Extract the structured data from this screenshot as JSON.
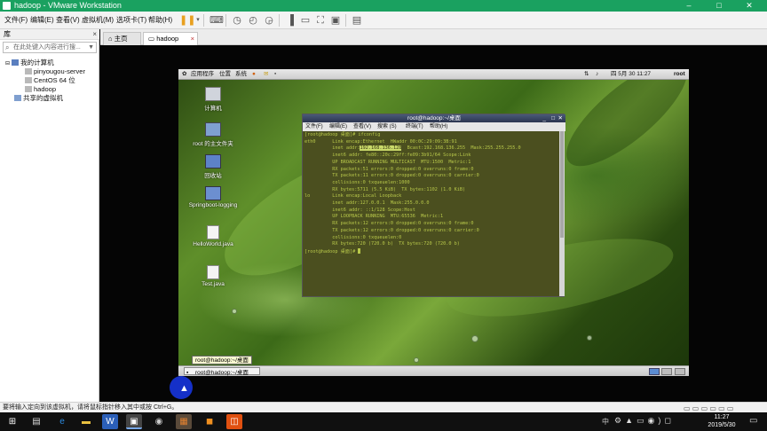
{
  "window": {
    "title": "hadoop - VMware Workstation",
    "controls": {
      "minimize": "–",
      "maximize": "□",
      "close": "✕"
    }
  },
  "menu": {
    "items": [
      "文件(F)",
      "编辑(E)",
      "查看(V)",
      "虚拟机(M)",
      "选项卡(T)",
      "帮助(H)"
    ]
  },
  "library": {
    "header": "库",
    "close": "×",
    "search_placeholder": "在此处键入内容进行搜...",
    "tree": {
      "root": "我的计算机",
      "items": [
        "pinyougou-server",
        "CentOS 64 位",
        "hadoop"
      ],
      "shared": "共享的虚拟机"
    }
  },
  "tabs": [
    {
      "label": "主页"
    },
    {
      "label": "hadoop",
      "close": "×"
    }
  ],
  "guest": {
    "top_panel": {
      "menus": [
        "应用程序",
        "位置",
        "系统"
      ],
      "clock": "四 5月 30 11:27",
      "user": "root"
    },
    "desktop_icons": [
      "计算机",
      "root 的主文件夹",
      "回收站",
      "Springboot-logging",
      "HelloWorld.java",
      "Test.java"
    ],
    "terminal": {
      "title": "root@hadoop:~/桌面",
      "menu": [
        "文件(F)",
        "编辑(E)",
        "查看(V)",
        "搜索 (S)",
        "终端(T)",
        "帮助(H)"
      ],
      "lines": [
        "[root@hadoop 桌面]# ifconfig",
        "eth0      Link encap:Ethernet  HWaddr 00:0C:29:09:3B:91",
        "inet6 addr: fe80::20c:29ff:fe09:3b91/64 Scope:Link",
        "          UP BROADCAST RUNNING MULTICAST  MTU:1500  Metric:1",
        "          RX packets:51 errors:0 dropped:0 overruns:0 frame:0",
        "          TX packets:11 errors:0 dropped:0 overruns:0 carrier:0",
        "          collisions:0 txqueuelen:1000",
        "          RX bytes:5711 (5.5 KiB)  TX bytes:1102 (1.0 KiB)",
        "",
        "lo        Link encap:Local Loopback",
        "          inet addr:127.0.0.1  Mask:255.0.0.0",
        "          inet6 addr: ::1/128 Scope:Host",
        "          UP LOOPBACK RUNNING  MTU:65536  Metric:1",
        "          RX packets:12 errors:0 dropped:0 overruns:0 frame:0",
        "          TX packets:12 errors:0 dropped:0 overruns:0 carrier:0",
        "          collisions:0 txqueuelen:0",
        "          RX bytes:720 (720.0 b)  TX bytes:720 (720.0 b)",
        "",
        "[root@hadoop 桌面]# "
      ],
      "inet_prefix": "          inet addr:",
      "inet_ip": "192.168.136.128",
      "inet_suffix": "  Bcast:192.168.136.255  Mask:255.255.255.0"
    },
    "bottom_panel": {
      "tooltip": "root@hadoop:~/桌面",
      "task": "root@hadoop:~/桌面"
    }
  },
  "statusbar": {
    "text": "要将输入定向到该虚拟机，请将鼠标指针移入其中或按 Ctrl+G。"
  },
  "taskbar": {
    "time": "11:27",
    "date": "2019/5/30",
    "tray_text": "中"
  },
  "colors": {
    "vmware_green": "#1aa160",
    "terminal_bg": "#4b4f1f",
    "terminal_fg": "#b8c84a"
  }
}
